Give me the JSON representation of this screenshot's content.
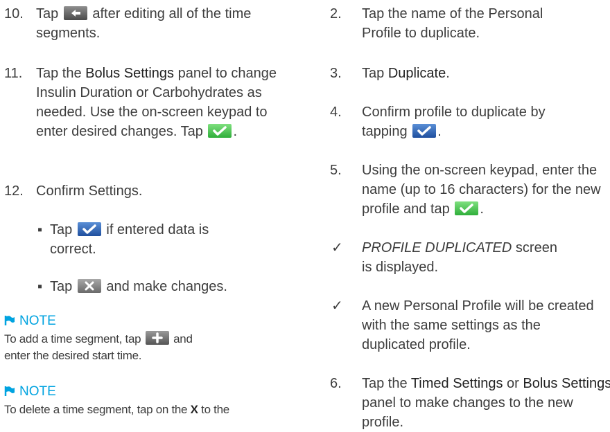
{
  "left": {
    "step10": {
      "num": "10.",
      "pre": "Tap",
      "post": "after editing all of the time segments."
    },
    "step11": {
      "num": "11.",
      "pre": "Tap the",
      "bold": "Bolus Settings",
      "mid": "panel to change Insulin Duration or Carbohydrates as needed. Use the on-screen keypad to enter desired changes. Tap",
      "post": "."
    },
    "step12": {
      "num": "12.",
      "text": "Confirm Settings."
    },
    "bullet1": {
      "dot": "▪",
      "pre": "Tap",
      "post": "if entered data is correct."
    },
    "bullet2": {
      "dot": "▪",
      "pre": "Tap",
      "post": "and make changes."
    },
    "note1": {
      "heading": "NOTE",
      "pre": "To add a time segment, tap",
      "post": "and enter the desired start time."
    },
    "note2": {
      "heading": "NOTE",
      "text": "To delete a time segment, tap on the",
      "bold": "X",
      "post": "to the"
    }
  },
  "right": {
    "step2": {
      "num": "2.",
      "text": "Tap the name of the Personal Profile to duplicate."
    },
    "step3": {
      "num": "3.",
      "pre": "Tap",
      "bold": "Duplicate",
      "post": "."
    },
    "step4": {
      "num": "4.",
      "pre": "Confirm profile to duplicate by tapping",
      "post": "."
    },
    "step5": {
      "num": "5.",
      "pre": "Using the on-screen keypad, enter the name (up to 16 characters) for the new profile and tap",
      "post": "."
    },
    "check1": {
      "mark": "✓",
      "italic": "PROFILE DUPLICATED",
      "post": "screen is displayed."
    },
    "check2": {
      "mark": "✓",
      "text": "A new Personal Profile will be created with the same settings as the duplicated profile."
    },
    "step6": {
      "num": "6.",
      "pre": "Tap the",
      "bold1": "Timed Settings",
      "mid": "or",
      "bold2": "Bolus Settings",
      "post": "panel to make changes to the new profile."
    }
  },
  "colors": {
    "note_heading": "#00a3e0",
    "text": "#3d3d3d",
    "confirm_blue": "#2a5db0",
    "confirm_green": "#3cc24a"
  },
  "icons": [
    "back-arrow-icon",
    "checkmark-icon",
    "close-x-icon",
    "plus-icon",
    "flag-icon"
  ]
}
